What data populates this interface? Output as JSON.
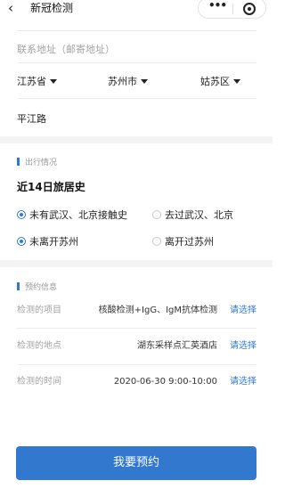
{
  "nav": {
    "back_icon": "‹",
    "title": "新冠检测",
    "more_icon": "•••"
  },
  "address": {
    "label": "联系地址（邮寄地址）",
    "province": "江苏省",
    "city": "苏州市",
    "district": "姑苏区",
    "street": "平江路"
  },
  "travel": {
    "section_title": "出行情况",
    "question": "近14日旅居史",
    "options_row1": [
      {
        "label": "未有武汉、北京接触史",
        "selected": true
      },
      {
        "label": "去过武汉、北京",
        "selected": false
      }
    ],
    "options_row2": [
      {
        "label": "未离开苏州",
        "selected": true
      },
      {
        "label": "离开过苏州",
        "selected": false
      }
    ]
  },
  "booking": {
    "section_title": "预约信息",
    "rows": [
      {
        "label": "检测的项目",
        "value": "核酸检测+IgG、IgM抗体检测",
        "action": "请选择"
      },
      {
        "label": "检测的地点",
        "value": "湖东采样点汇英酒店",
        "action": "请选择"
      },
      {
        "label": "检测的时间",
        "value": "2020-06-30 9:00-10:00",
        "action": "请选择"
      }
    ]
  },
  "submit_label": "我要预约",
  "colors": {
    "accent": "#2f7ad4",
    "button": "#3378cf"
  }
}
